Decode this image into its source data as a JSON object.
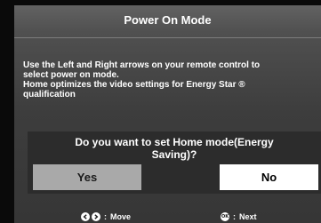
{
  "dialog_title": "Power On Mode",
  "description": {
    "line1": "Use the Left and Right arrows on your remote control to",
    "line2": "select power on mode.",
    "line3": "Home optimizes the video settings for Energy Star ®",
    "line4": "qualification"
  },
  "prompt": {
    "question_line1": "Do you want to set Home mode(Energy",
    "question_line2": "Saving)?",
    "yes_label": "Yes",
    "no_label": "No",
    "selected": "No"
  },
  "footer": {
    "move_label": "Move",
    "next_label": "Next",
    "separator": ":",
    "ok_icon_text": "OK"
  },
  "icons": {
    "left": "left-arrow-icon",
    "right": "right-arrow-icon",
    "ok": "ok-button-icon"
  },
  "colors": {
    "background": "#0a0a0a",
    "panel": "#505050",
    "dialog": "#2c2c2c",
    "yes_button": "#a9a9a9",
    "no_button_selected": "#ffffff"
  }
}
